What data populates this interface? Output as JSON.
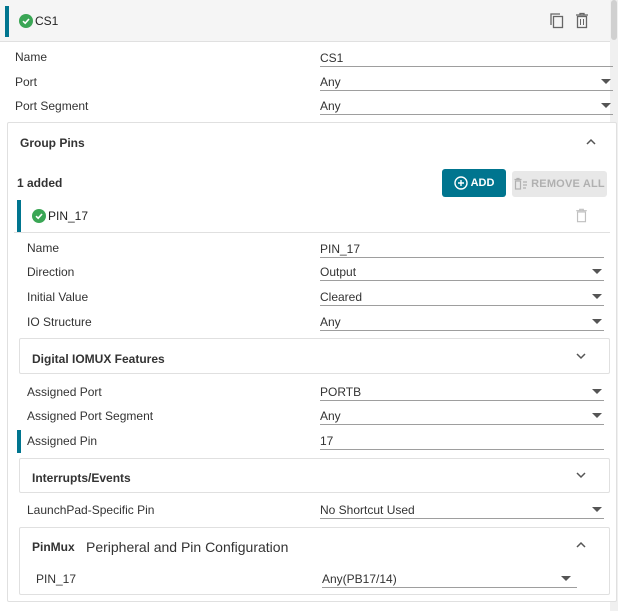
{
  "header": {
    "title": "CS1"
  },
  "cs1": {
    "name_label": "Name",
    "name_value": "CS1",
    "port_label": "Port",
    "port_value": "Any",
    "segment_label": "Port Segment",
    "segment_value": "Any"
  },
  "group_pins": {
    "title": "Group Pins",
    "added": "1 added",
    "add_label": "ADD",
    "remove_all_label": "REMOVE ALL"
  },
  "pin": {
    "title": "PIN_17",
    "name_label": "Name",
    "name_value": "PIN_17",
    "direction_label": "Direction",
    "direction_value": "Output",
    "initial_label": "Initial Value",
    "initial_value": "Cleared",
    "io_label": "IO Structure",
    "io_value": "Any"
  },
  "digital_iomux": {
    "title": "Digital IOMUX Features",
    "assigned_port_label": "Assigned Port",
    "assigned_port_value": "PORTB",
    "assigned_segment_label": "Assigned Port Segment",
    "assigned_segment_value": "Any",
    "assigned_pin_label": "Assigned Pin",
    "assigned_pin_value": "17"
  },
  "interrupts": {
    "title": "Interrupts/Events"
  },
  "launchpad": {
    "label": "LaunchPad-Specific Pin",
    "value": "No Shortcut Used"
  },
  "pinmux": {
    "tag": "PinMux",
    "title": "Peripheral and Pin Configuration",
    "row_label": "PIN_17",
    "row_value": "Any(PB17/14)"
  },
  "colors": {
    "accent": "#00758f",
    "check": "#3aa655"
  }
}
